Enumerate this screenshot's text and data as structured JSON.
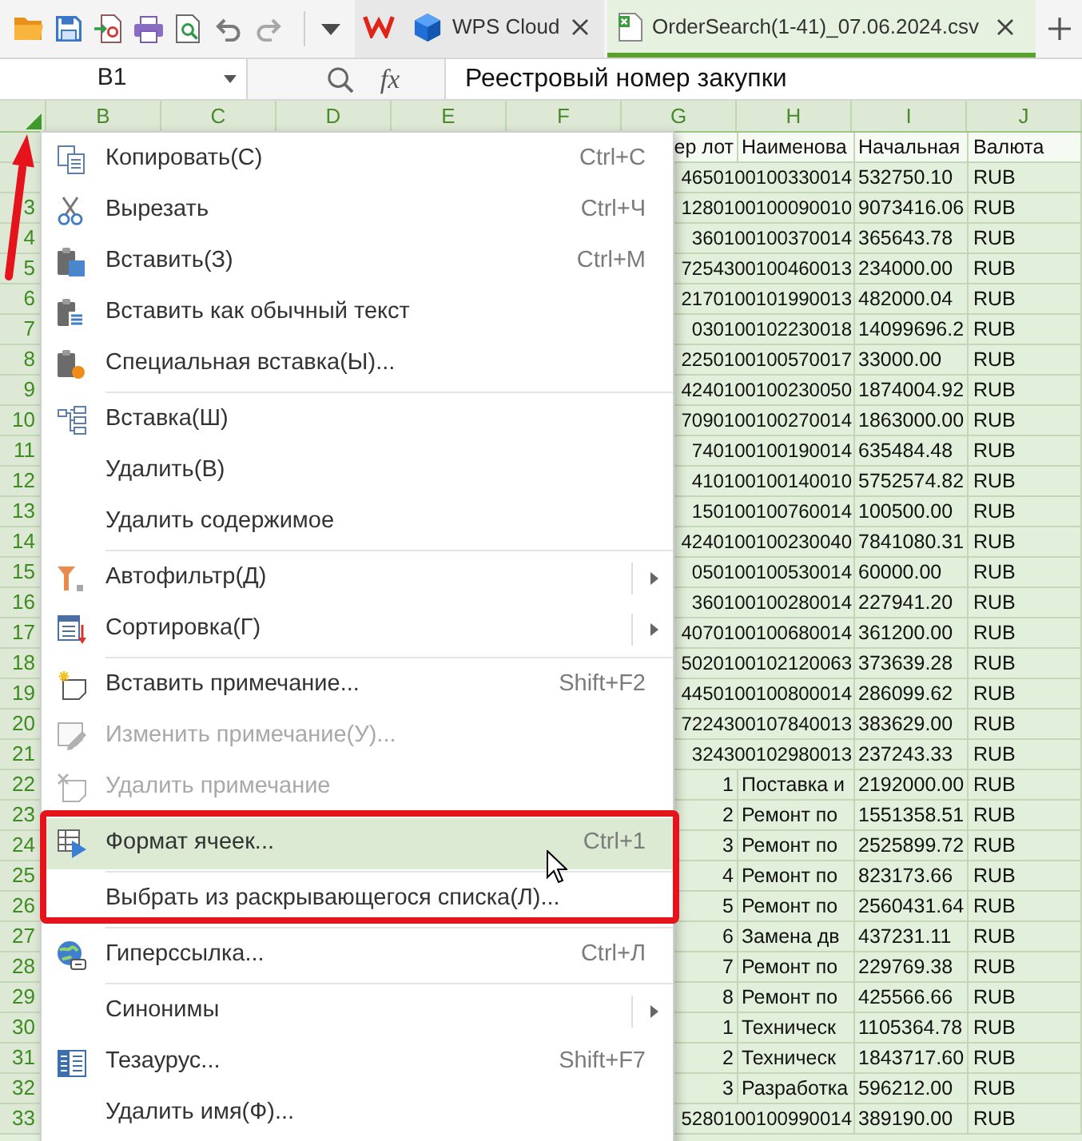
{
  "toolbar": {
    "tabs": [
      {
        "kind": "home",
        "selected": false
      },
      {
        "kind": "cloud",
        "label": "WPS Cloud",
        "selected": false
      },
      {
        "kind": "document",
        "label": "OrderSearch(1-41)_07.06.2024.csv",
        "selected": true
      }
    ]
  },
  "formula_bar": {
    "cell_reference": "B1",
    "function_label": "fx",
    "formula": "Реестровый номер закупки"
  },
  "sheet": {
    "columns": [
      "B",
      "C",
      "D",
      "E",
      "F",
      "G",
      "H",
      "I",
      "J"
    ],
    "rows": [
      {
        "G": "ер лот",
        "H": "Наименова",
        "I": "Начальная",
        "J": "Валюта"
      },
      {
        "G": "4650100100330014",
        "I": "532750.10",
        "J": "RUB"
      },
      {
        "number": "3",
        "G": "1280100100090010",
        "I": "9073416.06",
        "J": "RUB"
      },
      {
        "number": "4",
        "G": "360100100370014",
        "I": "365643.78",
        "J": "RUB"
      },
      {
        "number": "5",
        "G": "7254300100460013",
        "I": "234000.00",
        "J": "RUB"
      },
      {
        "number": "6",
        "G": "2170100101990013",
        "I": "482000.04",
        "J": "RUB"
      },
      {
        "number": "7",
        "G": "030100102230018",
        "I": "14099696.2",
        "J": "RUB"
      },
      {
        "number": "8",
        "G": "2250100100570017",
        "I": "33000.00",
        "J": "RUB"
      },
      {
        "number": "9",
        "G": "4240100100230050",
        "I": "1874004.92",
        "J": "RUB"
      },
      {
        "number": "10",
        "G": "7090100100270014",
        "I": "1863000.00",
        "J": "RUB"
      },
      {
        "number": "11",
        "G": "740100100190014",
        "I": "635484.48",
        "J": "RUB"
      },
      {
        "number": "12",
        "G": "410100100140010",
        "I": "5752574.82",
        "J": "RUB"
      },
      {
        "number": "13",
        "G": "150100100760014",
        "I": "100500.00",
        "J": "RUB"
      },
      {
        "number": "14",
        "G": "4240100100230040",
        "I": "7841080.31",
        "J": "RUB"
      },
      {
        "number": "15",
        "G": "050100100530014",
        "I": "60000.00",
        "J": "RUB"
      },
      {
        "number": "16",
        "G": "360100100280014",
        "I": "227941.20",
        "J": "RUB"
      },
      {
        "number": "17",
        "G": "4070100100680014",
        "I": "361200.00",
        "J": "RUB"
      },
      {
        "number": "18",
        "G": "5020100102120063",
        "I": "373639.28",
        "J": "RUB"
      },
      {
        "number": "19",
        "G": "4450100100800014",
        "I": "286099.62",
        "J": "RUB"
      },
      {
        "number": "20",
        "G": "7224300107840013",
        "I": "383629.00",
        "J": "RUB"
      },
      {
        "number": "21",
        "G": "324300102980013",
        "I": "237243.33",
        "J": "RUB"
      },
      {
        "number": "22",
        "G": "1",
        "H": "Поставка и",
        "I": "2192000.00",
        "J": "RUB"
      },
      {
        "number": "23",
        "G": "2",
        "H": "Ремонт по",
        "I": "1551358.51",
        "J": "RUB"
      },
      {
        "number": "24",
        "G": "3",
        "H": "Ремонт по",
        "I": "2525899.72",
        "J": "RUB"
      },
      {
        "number": "25",
        "G": "4",
        "H": "Ремонт по",
        "I": "823173.66",
        "J": "RUB"
      },
      {
        "number": "26",
        "G": "5",
        "H": "Ремонт по",
        "I": "2560431.64",
        "J": "RUB"
      },
      {
        "number": "27",
        "G": "6",
        "H": "Замена дв",
        "I": "437231.11",
        "J": "RUB"
      },
      {
        "number": "28",
        "G": "7",
        "H": "Ремонт по",
        "I": "229769.38",
        "J": "RUB"
      },
      {
        "number": "29",
        "G": "8",
        "H": "Ремонт по",
        "I": "425566.66",
        "J": "RUB"
      },
      {
        "number": "30",
        "G": "1",
        "H": "Техническ",
        "I": "1105364.78",
        "J": "RUB"
      },
      {
        "number": "31",
        "G": "2",
        "H": "Техническ",
        "I": "1843717.60",
        "J": "RUB"
      },
      {
        "number": "32",
        "G": "3",
        "H": "Разработка",
        "I": "596212.00",
        "J": "RUB"
      },
      {
        "number": "33",
        "G": "5280100100990014",
        "I": "389190.00",
        "J": "RUB"
      }
    ]
  },
  "context_menu": {
    "groups": [
      [
        {
          "label": "Копировать(С)",
          "shortcut": "Ctrl+С",
          "disabled": false,
          "highlighted": false,
          "submenu": false
        },
        {
          "label": "Вырезать",
          "shortcut": "Ctrl+Ч",
          "disabled": false,
          "highlighted": false,
          "submenu": false
        },
        {
          "label": "Вставить(З)",
          "shortcut": "Ctrl+М",
          "disabled": false,
          "highlighted": false,
          "submenu": false
        },
        {
          "label": "Вставить как обычный текст",
          "disabled": false,
          "highlighted": false,
          "submenu": false
        },
        {
          "label": "Специальная вставка(Ы)...",
          "disabled": false,
          "highlighted": false,
          "submenu": false
        }
      ],
      [
        {
          "label": "Вставка(Ш)",
          "disabled": false,
          "highlighted": false,
          "submenu": false
        },
        {
          "label": "Удалить(В)",
          "disabled": false,
          "highlighted": false,
          "submenu": false
        },
        {
          "label": "Удалить содержимое",
          "disabled": false,
          "highlighted": false,
          "submenu": false
        }
      ],
      [
        {
          "label": "Автофильтр(Д)",
          "disabled": false,
          "highlighted": false,
          "submenu": true
        },
        {
          "label": "Сортировка(Г)",
          "disabled": false,
          "highlighted": false,
          "submenu": true
        }
      ],
      [
        {
          "label": "Вставить примечание...",
          "shortcut": "Shift+F2",
          "disabled": false,
          "highlighted": false,
          "submenu": false
        },
        {
          "label": "Изменить примечание(У)...",
          "disabled": true,
          "highlighted": false,
          "submenu": false
        },
        {
          "label": "Удалить примечание",
          "disabled": true,
          "highlighted": false,
          "submenu": false
        }
      ],
      [
        {
          "label": "Формат ячеек...",
          "shortcut": "Ctrl+1",
          "disabled": false,
          "highlighted": true,
          "submenu": false
        }
      ],
      [
        {
          "label": "Выбрать из раскрывающегося списка(Л)...",
          "disabled": false,
          "highlighted": false,
          "submenu": false
        }
      ],
      [
        {
          "label": "Гиперссылка...",
          "shortcut": "Ctrl+Л",
          "disabled": false,
          "highlighted": false,
          "submenu": false
        }
      ],
      [
        {
          "label": "Синонимы",
          "disabled": false,
          "highlighted": false,
          "submenu": true
        },
        {
          "label": "Тезаурус...",
          "shortcut": "Shift+F7",
          "disabled": false,
          "highlighted": false,
          "submenu": false
        },
        {
          "label": "Удалить имя(Ф)...",
          "disabled": false,
          "highlighted": false,
          "submenu": false
        }
      ]
    ]
  }
}
